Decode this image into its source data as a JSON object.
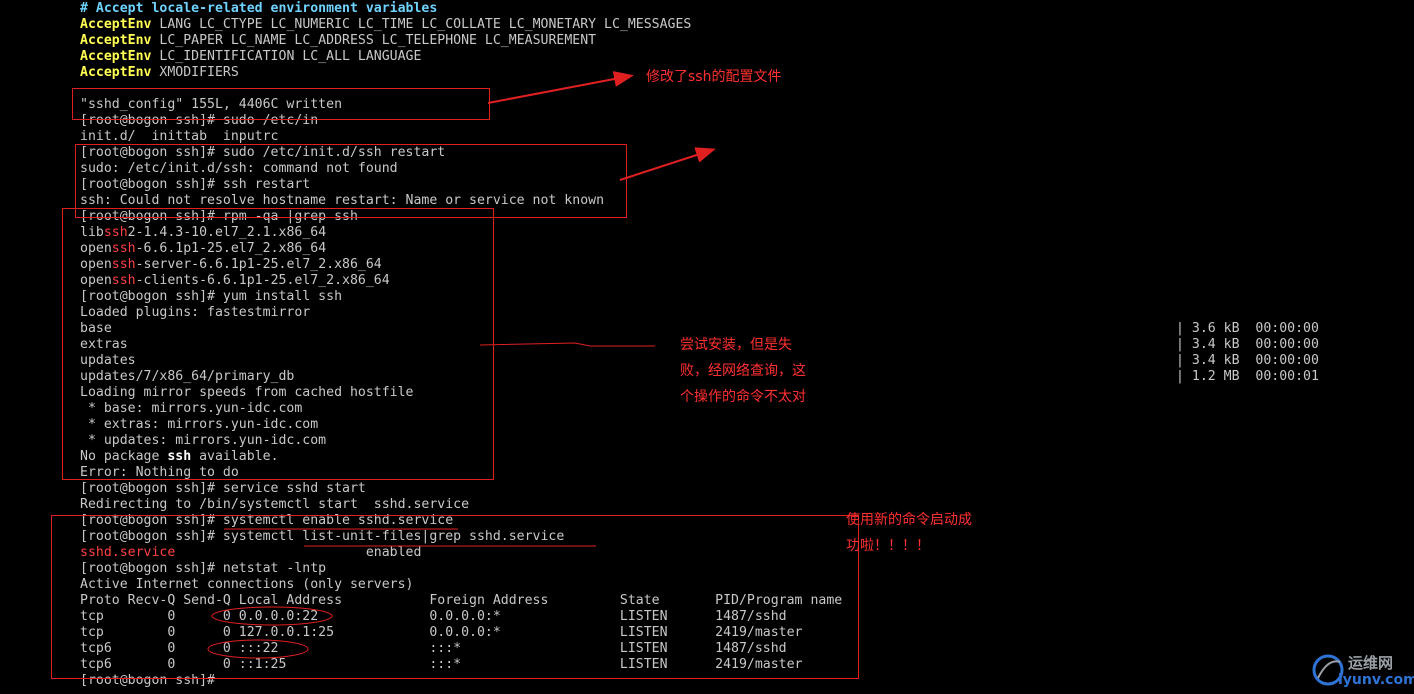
{
  "terminal": {
    "comment_line": "# Accept locale-related environment variables",
    "accept_env": [
      {
        "kw": "AcceptEnv",
        "rest": " LANG LC_CTYPE LC_NUMERIC LC_TIME LC_COLLATE LC_MONETARY LC_MESSAGES"
      },
      {
        "kw": "AcceptEnv",
        "rest": " LC_PAPER LC_NAME LC_ADDRESS LC_TELEPHONE LC_MEASUREMENT"
      },
      {
        "kw": "AcceptEnv",
        "rest": " LC_IDENTIFICATION LC_ALL LANGUAGE"
      },
      {
        "kw": "AcceptEnv",
        "rest": " XMODIFIERS"
      }
    ],
    "written": "\"sshd_config\" 155L, 4406C written",
    "l_sudo_etc": "[root@bogon ssh]# sudo /etc/in",
    "l_initd": "init.d/  inittab  inputrc",
    "l_sudo_restart": "[root@bogon ssh]# sudo /etc/init.d/ssh restart",
    "l_sudo_notfound": "sudo: /etc/init.d/ssh: command not found",
    "l_ssh_restart": "[root@bogon ssh]# ssh restart",
    "l_ssh_err": "ssh: Could not resolve hostname restart: Name or service not known",
    "l_rpm": "[root@bogon ssh]# rpm -qa |grep ssh",
    "pkg1_a": "lib",
    "pkg1_b": "ssh",
    "pkg1_c": "2-1.4.3-10.el7_2.1.x86_64",
    "pkg2_a": "open",
    "pkg2_b": "ssh",
    "pkg2_c": "-6.6.1p1-25.el7_2.x86_64",
    "pkg3_a": "open",
    "pkg3_b": "ssh",
    "pkg3_c": "-server-6.6.1p1-25.el7_2.x86_64",
    "pkg4_a": "open",
    "pkg4_b": "ssh",
    "pkg4_c": "-clients-6.6.1p1-25.el7_2.x86_64",
    "l_yum": "[root@bogon ssh]# yum install ssh",
    "l_loaded": "Loaded plugins: fastestmirror",
    "l_base": "base",
    "l_extras": "extras",
    "l_updates": "updates",
    "l_primary": "updates/7/x86_64/primary_db",
    "l_loading": "Loading mirror speeds from cached hostfile",
    "l_m_base": " * base: mirrors.yun-idc.com",
    "l_m_extras": " * extras: mirrors.yun-idc.com",
    "l_m_updates": " * updates: mirrors.yun-idc.com",
    "nopkg_a": "No package ",
    "nopkg_b": "ssh",
    "nopkg_c": " available.",
    "l_error": "Error: Nothing to do",
    "l_service": "[root@bogon ssh]# service sshd start",
    "l_redirect": "Redirecting to /bin/systemctl start  sshd.service",
    "l_enable": "[root@bogon ssh]# systemctl enable sshd.service",
    "l_listunit": "[root@bogon ssh]# systemctl list-unit-files|grep sshd.service",
    "unit_name": "sshd.service",
    "unit_state": "                        enabled",
    "l_netstat": "[root@bogon ssh]# netstat -lntp",
    "l_active": "Active Internet connections (only servers)",
    "l_header": "Proto Recv-Q Send-Q Local Address           Foreign Address         State       PID/Program name",
    "l_r1": "tcp        0      0 0.0.0.0:22              0.0.0.0:*               LISTEN      1487/sshd",
    "l_r2": "tcp        0      0 127.0.0.1:25            0.0.0.0:*               LISTEN      2419/master",
    "l_r3": "tcp6       0      0 :::22                   :::*                    LISTEN      1487/sshd",
    "l_r4": "tcp6       0      0 ::1:25                  :::*                    LISTEN      2419/master",
    "l_prompt": "[root@bogon ssh]# "
  },
  "downloads": [
    "| 3.6 kB  00:00:00",
    "| 3.4 kB  00:00:00",
    "| 3.4 kB  00:00:00",
    "| 1.2 MB  00:00:01"
  ],
  "annotations": {
    "a1": "修改了ssh的配置文件",
    "a2_l1": "尝试安装，但是失",
    "a2_l2": "败，经网络查询，这",
    "a2_l3": "个操作的命令不太对",
    "a3_l1": "使用新的命令启动成",
    "a3_l2": "功啦！！！！"
  },
  "watermark": {
    "name": "运维网",
    "url": "iyunv.com"
  },
  "colors": {
    "comment": "#6fd3ff",
    "keyword": "#ffff55",
    "highlight": "#ff4040",
    "annotation": "#ff3030"
  }
}
